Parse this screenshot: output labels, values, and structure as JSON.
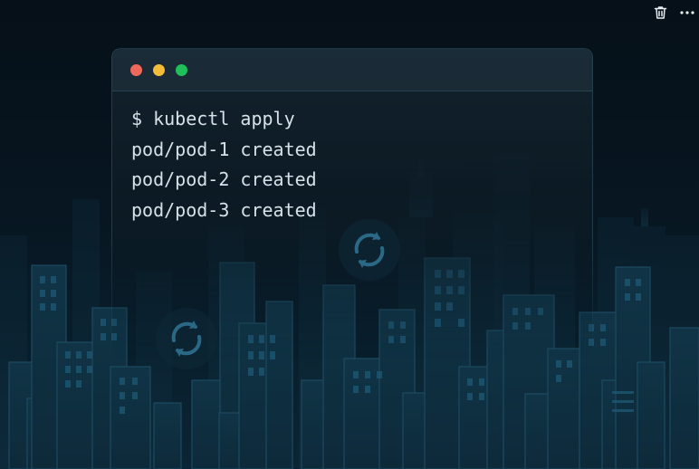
{
  "toolbar": {
    "icons": [
      "trash-icon",
      "more-icon"
    ]
  },
  "terminal": {
    "window_controls": [
      {
        "name": "close",
        "color": "#f0685a"
      },
      {
        "name": "minimize",
        "color": "#f5bc3a"
      },
      {
        "name": "maximize",
        "color": "#1fbf5a"
      }
    ],
    "lines": [
      "$ kubectl apply",
      "pod/pod-1 created",
      "pod/pod-2 created",
      "pod/pod-3 created"
    ]
  },
  "decor": {
    "icons": [
      "sync-icon",
      "sync-icon"
    ],
    "background": "night-city-skyline"
  }
}
